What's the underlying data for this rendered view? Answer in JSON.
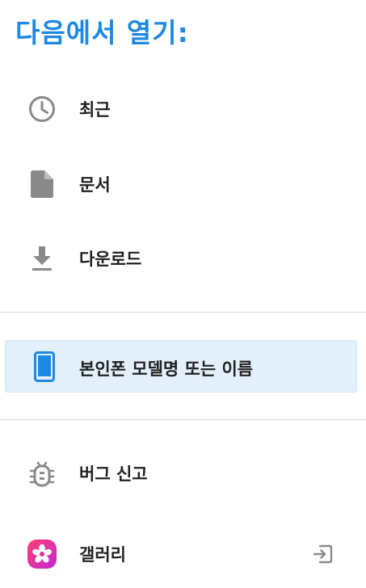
{
  "header": {
    "title": "다음에서 열기:"
  },
  "roots": [
    {
      "label": "최근",
      "icon": "clock-icon"
    },
    {
      "label": "문서",
      "icon": "document-icon"
    },
    {
      "label": "다운로드",
      "icon": "download-icon"
    }
  ],
  "device": {
    "label": "본인폰 모델명 또는 이름",
    "icon": "phone-icon",
    "selected": true
  },
  "apps": [
    {
      "label": "버그 신고",
      "icon": "bug-icon"
    },
    {
      "label": "갤러리",
      "icon": "gallery-app-icon",
      "trailing_icon": "open-in-icon"
    }
  ],
  "colors": {
    "accent": "#1e88e5",
    "selected_bg": "#e3f0fc",
    "icon_gray": "#8a8a8a",
    "gallery_gradient": [
      "#ff3d6e",
      "#c12ad8"
    ]
  }
}
